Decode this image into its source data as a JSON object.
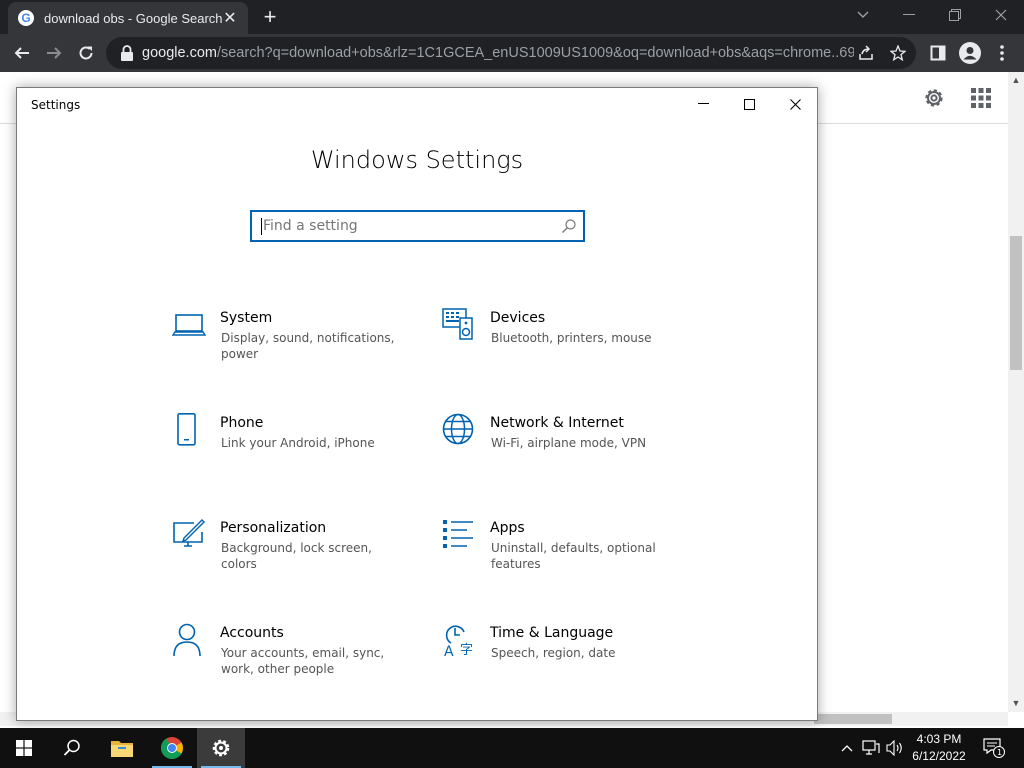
{
  "browser": {
    "tab_title": "download obs - Google Search",
    "tab_close": "✕",
    "new_tab": "+",
    "url_host": "google.com",
    "url_path": "/search?q=download+obs&rlz=1C1GCEA_enUS1009US1009&oq=download+obs&aqs=chrome..69i..."
  },
  "settings": {
    "window_title": "Settings",
    "heading": "Windows Settings",
    "search_placeholder": "Find a setting",
    "categories": [
      {
        "name": "System",
        "desc": "Display, sound, notifications, power",
        "icon": "laptop-icon"
      },
      {
        "name": "Devices",
        "desc": "Bluetooth, printers, mouse",
        "icon": "keyboard-speaker-icon"
      },
      {
        "name": "Phone",
        "desc": "Link your Android, iPhone",
        "icon": "phone-icon"
      },
      {
        "name": "Network & Internet",
        "desc": "Wi-Fi, airplane mode, VPN",
        "icon": "globe-icon"
      },
      {
        "name": "Personalization",
        "desc": "Background, lock screen, colors",
        "icon": "paint-screen-icon"
      },
      {
        "name": "Apps",
        "desc": "Uninstall, defaults, optional features",
        "icon": "apps-list-icon"
      },
      {
        "name": "Accounts",
        "desc": "Your accounts, email, sync, work, other people",
        "icon": "person-icon"
      },
      {
        "name": "Time & Language",
        "desc": "Speech, region, date",
        "icon": "time-language-icon"
      }
    ]
  },
  "taskbar": {
    "time": "4:03 PM",
    "date": "6/12/2022",
    "notification_count": "1"
  },
  "colors": {
    "accent": "#0063b1",
    "chrome_dark": "#202124",
    "chrome_toolbar": "#35363a",
    "taskbar": "#101010"
  }
}
